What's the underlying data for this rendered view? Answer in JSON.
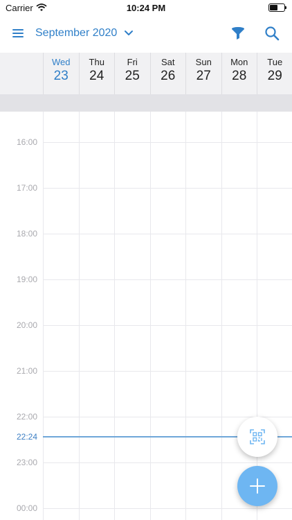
{
  "status_bar": {
    "carrier": "Carrier",
    "time": "10:24 PM"
  },
  "toolbar": {
    "month_label": "September 2020",
    "icons": [
      "menu-icon",
      "chevron-down-icon",
      "filter-icon",
      "search-icon"
    ]
  },
  "days": [
    {
      "name": "Wed",
      "num": "23",
      "today": true
    },
    {
      "name": "Thu",
      "num": "24"
    },
    {
      "name": "Fri",
      "num": "25"
    },
    {
      "name": "Sat",
      "num": "26"
    },
    {
      "name": "Sun",
      "num": "27"
    },
    {
      "name": "Mon",
      "num": "28"
    },
    {
      "name": "Tue",
      "num": "29"
    }
  ],
  "hours": [
    "16:00",
    "17:00",
    "18:00",
    "19:00",
    "20:00",
    "21:00",
    "22:00",
    "23:00",
    "00:00"
  ],
  "now": {
    "label": "22:24"
  },
  "colors": {
    "accent": "#2f7fc8",
    "fab_add": "#6eb6f2",
    "now_line": "#6fa6d8"
  },
  "fab_icons": [
    "scan-icon",
    "plus-icon"
  ]
}
